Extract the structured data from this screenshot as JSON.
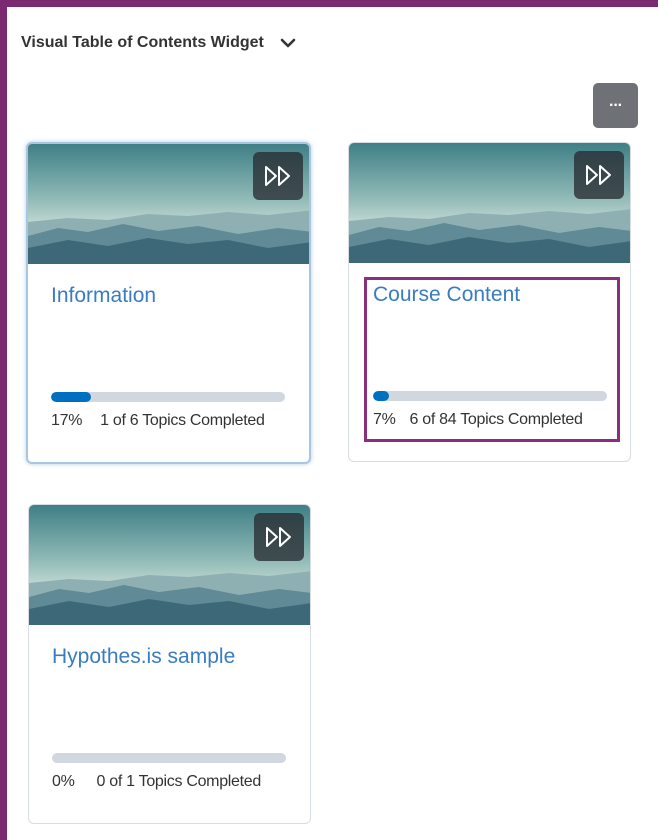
{
  "widget": {
    "title": "Visual Table of Contents Widget",
    "chevron_icon": "chevron-down-icon",
    "more_icon": "ellipsis-icon",
    "more_label": "···"
  },
  "cards": [
    {
      "title": "Information",
      "percent": "17%",
      "progress_fraction": 0.17,
      "completed_text": "1 of 6 Topics Completed",
      "icon": "play-icon"
    },
    {
      "title": "Course Content",
      "percent": "7%",
      "progress_fraction": 0.07,
      "completed_text": "6 of 84 Topics Completed",
      "icon": "play-icon"
    },
    {
      "title": "Hypothes.is sample",
      "percent": "0%",
      "progress_fraction": 0,
      "completed_text": "0 of 1 Topics Completed",
      "icon": "play-icon"
    }
  ],
  "colors": {
    "frame_border": "#7b2a72",
    "link": "#3a7cc1",
    "progress_fill": "#006fbf",
    "progress_track": "#d0d7df",
    "highlight": "#8a2f7c"
  }
}
